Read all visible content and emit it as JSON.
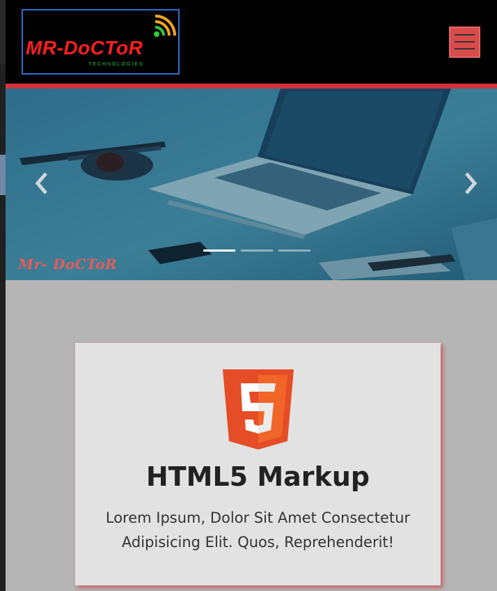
{
  "header": {
    "logo_text": "MR-DoCToR",
    "logo_subtext": "TECHNOLOGIES"
  },
  "carousel": {
    "prev_label": "‹",
    "next_label": "›",
    "slide_count": 3,
    "active_slide": 1,
    "watermark": "Mr- DoCToR"
  },
  "feature": {
    "icon": "html5-icon",
    "icon_digit": "5",
    "title": "HTML5 Markup",
    "description": "Lorem Ipsum, Dolor Sit Amet Consectetur Adipisicing Elit. Quos, Reprehenderit!"
  },
  "colors": {
    "accent": "#d3333c",
    "menu_button": "#d84b4b",
    "logo_text": "#ff1e1e",
    "logo_border": "#2f6fd1",
    "html5_orange": "#e44d26",
    "html5_light": "#f16529"
  }
}
